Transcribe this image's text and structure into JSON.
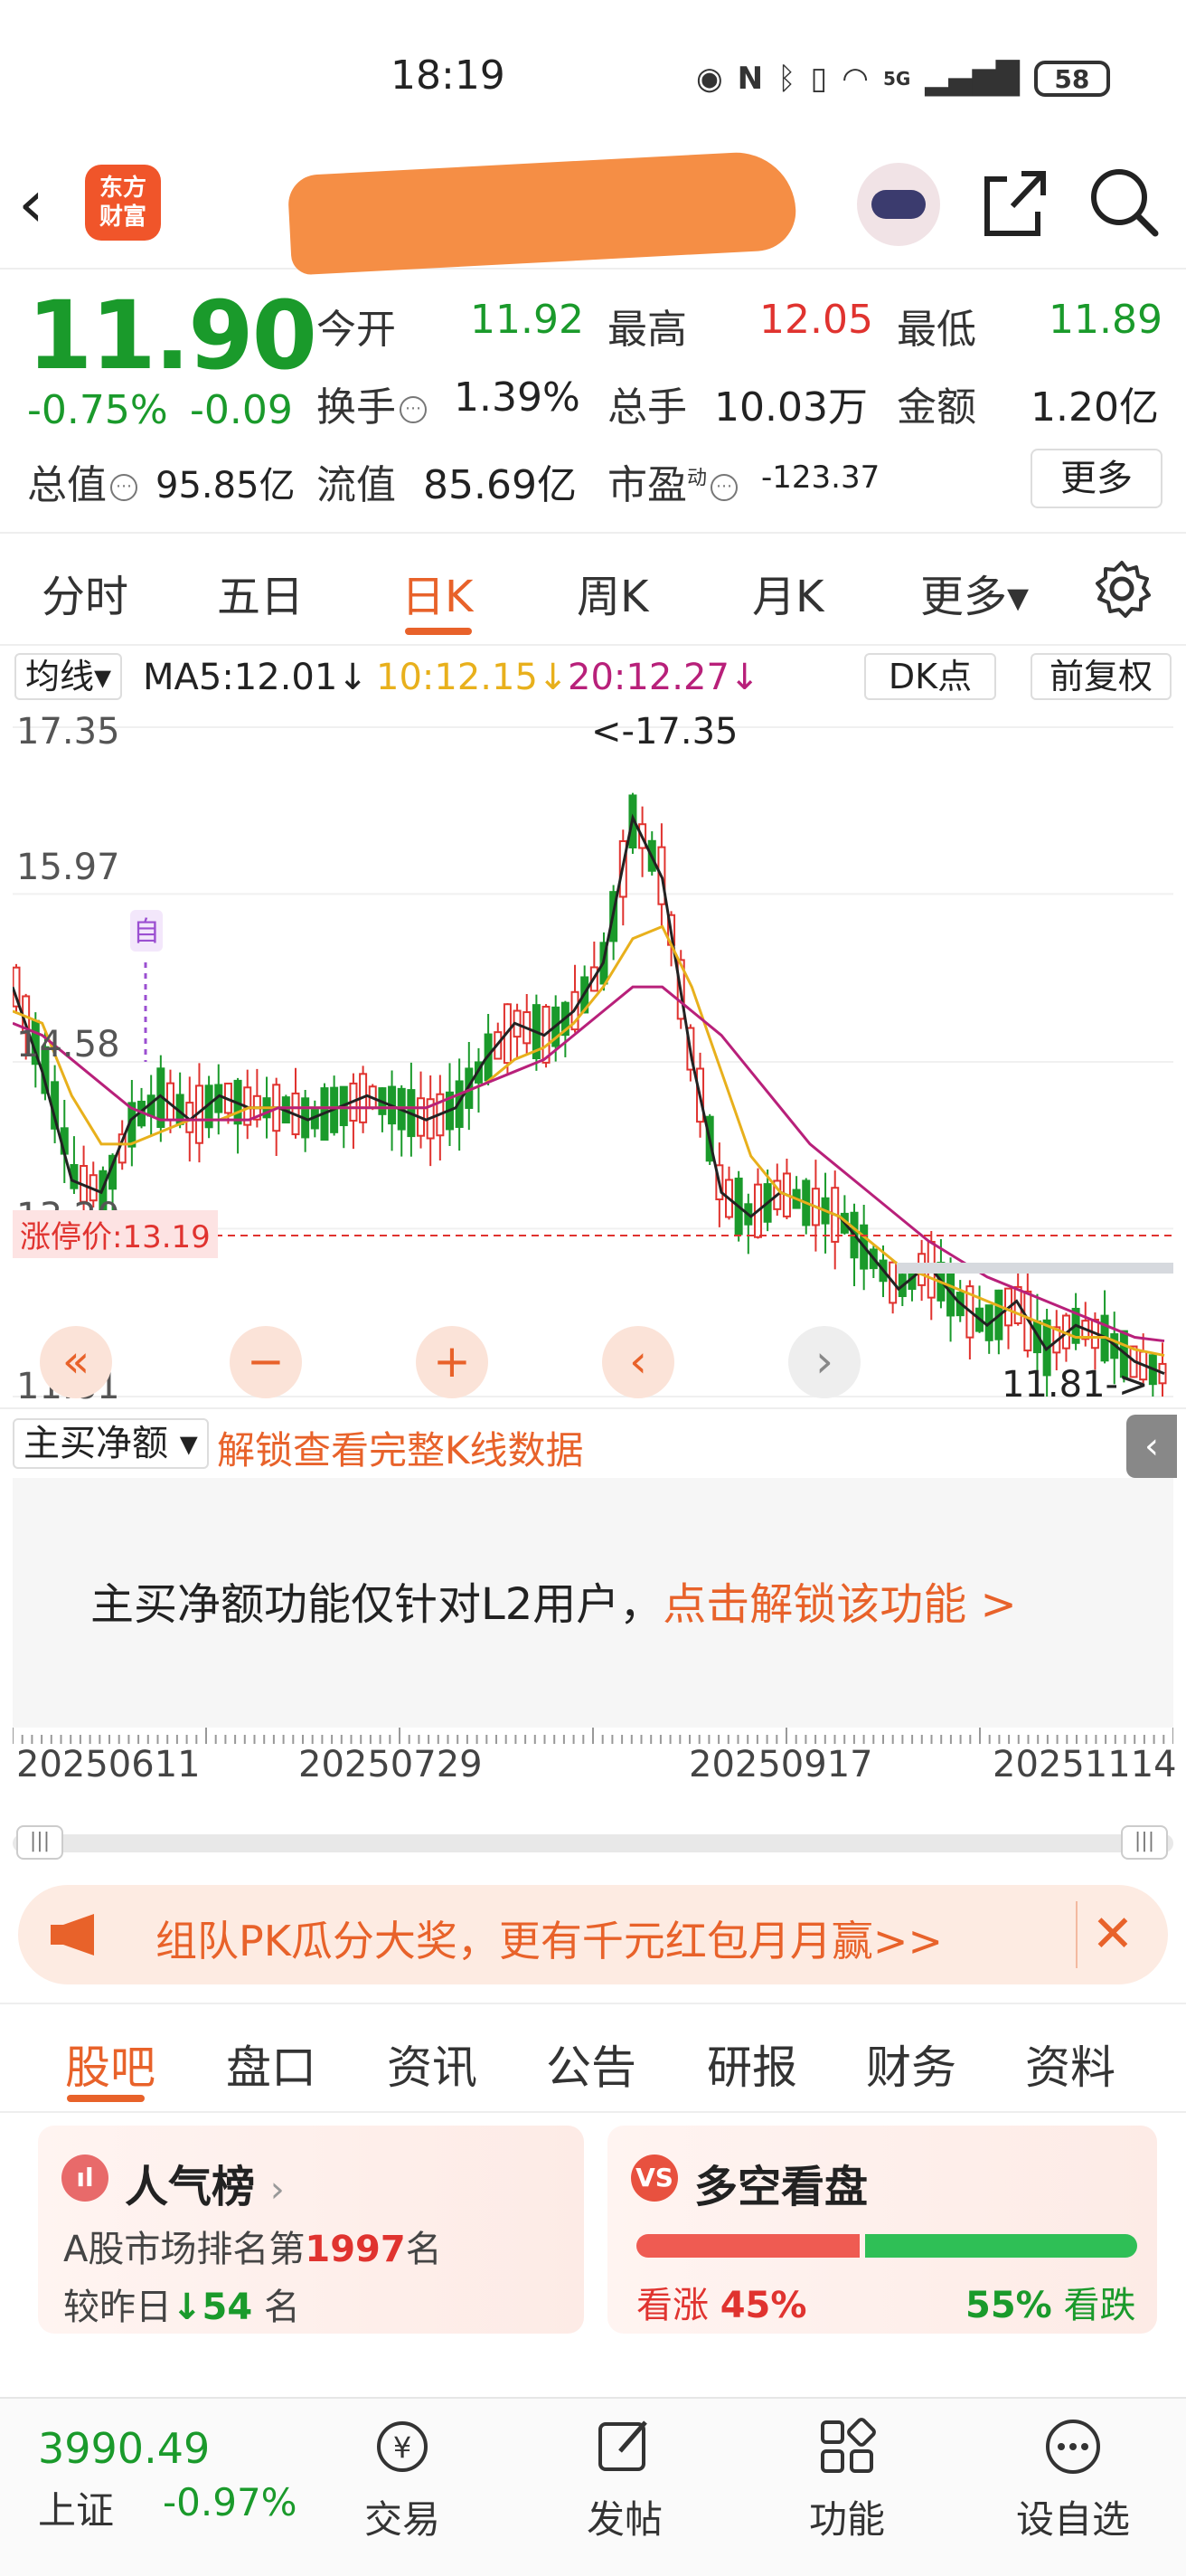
{
  "status": {
    "time": "18:19",
    "battery": "58",
    "network": "5G"
  },
  "header": {
    "logo_line1": "东方",
    "logo_line2": "财富"
  },
  "quote": {
    "price": "11.90",
    "change_pct": "-0.75%",
    "change": "-0.09",
    "open_label": "今开",
    "open": "11.92",
    "high_label": "最高",
    "high": "12.05",
    "low_label": "最低",
    "low": "11.89",
    "turnover_label": "换手",
    "turnover": "1.39%",
    "volume_label": "总手",
    "volume": "10.03万",
    "amount_label": "金额",
    "amount": "1.20亿",
    "mktcap_label": "总值",
    "mktcap": "95.85亿",
    "float_label": "流值",
    "float": "85.69亿",
    "pe_label": "市盈",
    "pe_sup": "动",
    "pe": "-123.37",
    "more_label": "更多"
  },
  "period_tabs": [
    "分时",
    "五日",
    "日K",
    "周K",
    "月K",
    "更多▾"
  ],
  "indicators": {
    "ma_select": "均线▾",
    "ma5": "MA5:12.01↓",
    "ma10": "10:12.15↓",
    "ma20": "20:12.27↓",
    "dk": "DK点",
    "fq": "前复权",
    "colors": {
      "ma5": "#222222",
      "ma10": "#e8b01c",
      "ma20": "#b8207a"
    }
  },
  "chart_labels": {
    "y_ticks": [
      "17.35",
      "15.97",
      "14.58",
      "13.20",
      "11.81"
    ],
    "max_marker": "<-17.35",
    "min_marker": "11.81->",
    "limit_label": "涨停价:13.19",
    "self_marker": "自"
  },
  "chart_data": {
    "type": "candlestick",
    "ylim": [
      11.81,
      17.35
    ],
    "limit_up_price": 13.19,
    "x_ticks": [
      "20250611",
      "20250729",
      "20250917",
      "20251114"
    ],
    "ma_series": [
      {
        "name": "MA5",
        "values": [
          15.2,
          14.5,
          13.6,
          13.5,
          14.1,
          14.3,
          14.1,
          14.3,
          14.2,
          14.2,
          14.1,
          14.2,
          14.3,
          14.2,
          14.1,
          14.2,
          14.6,
          14.9,
          14.8,
          15.0,
          15.4,
          16.6,
          16.1,
          14.6,
          13.5,
          13.3,
          13.5,
          13.4,
          13.3,
          13.0,
          12.7,
          12.9,
          12.6,
          12.4,
          12.6,
          12.2,
          12.4,
          12.3,
          12.1,
          12.0
        ]
      },
      {
        "name": "MA10",
        "values": [
          15.0,
          14.9,
          14.3,
          13.9,
          13.9,
          14.0,
          14.1,
          14.1,
          14.2,
          14.2,
          14.2,
          14.2,
          14.2,
          14.2,
          14.2,
          14.3,
          14.4,
          14.6,
          14.7,
          14.9,
          15.2,
          15.6,
          15.7,
          15.2,
          14.5,
          13.8,
          13.5,
          13.4,
          13.3,
          13.1,
          12.9,
          12.8,
          12.7,
          12.6,
          12.5,
          12.4,
          12.3,
          12.3,
          12.2,
          12.15
        ]
      },
      {
        "name": "MA20",
        "values": [
          14.9,
          14.8,
          14.6,
          14.4,
          14.2,
          14.1,
          14.1,
          14.1,
          14.1,
          14.2,
          14.2,
          14.2,
          14.2,
          14.2,
          14.2,
          14.3,
          14.4,
          14.5,
          14.6,
          14.8,
          15.0,
          15.2,
          15.2,
          15.0,
          14.8,
          14.5,
          14.2,
          13.9,
          13.7,
          13.5,
          13.3,
          13.1,
          12.95,
          12.8,
          12.7,
          12.6,
          12.5,
          12.4,
          12.3,
          12.27
        ]
      }
    ]
  },
  "controls": [
    "«",
    "−",
    "+",
    "‹",
    "›"
  ],
  "sub": {
    "select": "主买净额",
    "unlock": "解锁查看完整K线数据",
    "msg": "主买净额功能仅针对L2用户，",
    "msg_link": "点击解锁该功能 >"
  },
  "promo": {
    "text": "组队PK瓜分大奖，更有千元红包月月赢>>"
  },
  "content_tabs": [
    "股吧",
    "盘口",
    "资讯",
    "公告",
    "研报",
    "财务",
    "资料"
  ],
  "popularity": {
    "title": "人气榜",
    "line1_a": "A股市场排名第",
    "rank": "1997",
    "line1_b": "名",
    "line2_a": "较昨日",
    "delta": "54",
    "line2_b": "名"
  },
  "longshort": {
    "title": "多空看盘",
    "up_label": "看涨",
    "up_pct": "45%",
    "down_pct": "55%",
    "down_label": "看跌",
    "up_ratio": 0.45
  },
  "bottom": {
    "index_value": "3990.49",
    "index_name": "上证",
    "index_pct": "-0.97%",
    "nav": [
      "交易",
      "发帖",
      "功能",
      "设自选"
    ]
  }
}
